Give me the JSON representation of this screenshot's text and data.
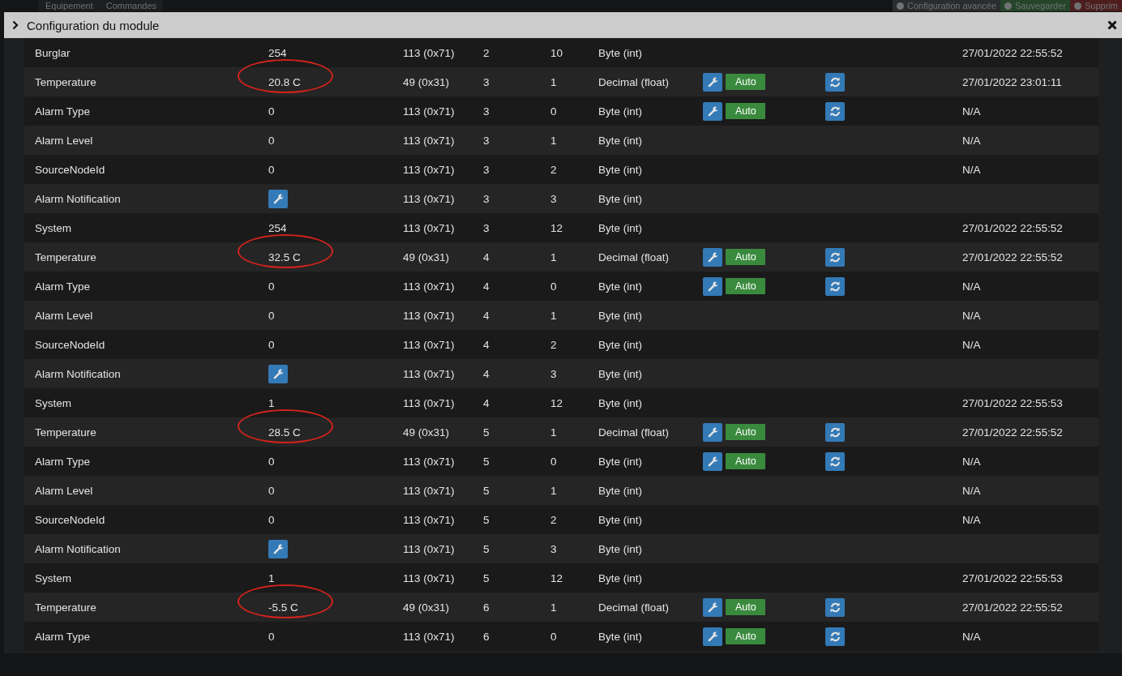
{
  "background_bar": {
    "tabs": [
      "Equipement",
      "Commandes"
    ],
    "buttons": [
      {
        "kind": "config",
        "label": "Configuration avancée"
      },
      {
        "kind": "save",
        "label": "Sauvegarder"
      },
      {
        "kind": "delete",
        "label": "Supprim"
      }
    ]
  },
  "modal": {
    "title": "Configuration du module",
    "rows": [
      {
        "name": "Burglar",
        "kind": "text",
        "value": "254",
        "circled": false,
        "instance": "113 (0x71)",
        "col_4": "2",
        "col_5": "10",
        "type": "Byte (int)",
        "actions": false,
        "refresh": false,
        "date": "27/01/2022 22:55:52"
      },
      {
        "name": "Temperature",
        "kind": "text",
        "value": "20.8 C",
        "circled": true,
        "instance": "49 (0x31)",
        "col_4": "3",
        "col_5": "1",
        "type": "Decimal (float)",
        "actions": true,
        "auto_label": "Auto",
        "refresh": true,
        "date": "27/01/2022 23:01:11"
      },
      {
        "name": "Alarm Type",
        "kind": "text",
        "value": "0",
        "circled": false,
        "instance": "113 (0x71)",
        "col_4": "3",
        "col_5": "0",
        "type": "Byte (int)",
        "actions": true,
        "auto_label": "Auto",
        "refresh": true,
        "date": "N/A"
      },
      {
        "name": "Alarm Level",
        "kind": "text",
        "value": "0",
        "circled": false,
        "instance": "113 (0x71)",
        "col_4": "3",
        "col_5": "1",
        "type": "Byte (int)",
        "actions": false,
        "refresh": false,
        "date": "N/A"
      },
      {
        "name": "SourceNodeId",
        "kind": "text",
        "value": "0",
        "circled": false,
        "instance": "113 (0x71)",
        "col_4": "3",
        "col_5": "2",
        "type": "Byte (int)",
        "actions": false,
        "refresh": false,
        "date": "N/A"
      },
      {
        "name": "Alarm Notification",
        "kind": "wrench",
        "circled": false,
        "instance": "113 (0x71)",
        "col_4": "3",
        "col_5": "3",
        "type": "Byte (int)",
        "actions": false,
        "refresh": false
      },
      {
        "name": "System",
        "kind": "text",
        "value": "254",
        "circled": false,
        "instance": "113 (0x71)",
        "col_4": "3",
        "col_5": "12",
        "type": "Byte (int)",
        "actions": false,
        "refresh": false,
        "date": "27/01/2022 22:55:52"
      },
      {
        "name": "Temperature",
        "kind": "text",
        "value": "32.5 C",
        "circled": true,
        "instance": "49 (0x31)",
        "col_4": "4",
        "col_5": "1",
        "type": "Decimal (float)",
        "actions": true,
        "auto_label": "Auto",
        "refresh": true,
        "date": "27/01/2022 22:55:52"
      },
      {
        "name": "Alarm Type",
        "kind": "text",
        "value": "0",
        "circled": false,
        "instance": "113 (0x71)",
        "col_4": "4",
        "col_5": "0",
        "type": "Byte (int)",
        "actions": true,
        "auto_label": "Auto",
        "refresh": true,
        "date": "N/A"
      },
      {
        "name": "Alarm Level",
        "kind": "text",
        "value": "0",
        "circled": false,
        "instance": "113 (0x71)",
        "col_4": "4",
        "col_5": "1",
        "type": "Byte (int)",
        "actions": false,
        "refresh": false,
        "date": "N/A"
      },
      {
        "name": "SourceNodeId",
        "kind": "text",
        "value": "0",
        "circled": false,
        "instance": "113 (0x71)",
        "col_4": "4",
        "col_5": "2",
        "type": "Byte (int)",
        "actions": false,
        "refresh": false,
        "date": "N/A"
      },
      {
        "name": "Alarm Notification",
        "kind": "wrench",
        "circled": false,
        "instance": "113 (0x71)",
        "col_4": "4",
        "col_5": "3",
        "type": "Byte (int)",
        "actions": false,
        "refresh": false
      },
      {
        "name": "System",
        "kind": "text",
        "value": "1",
        "circled": false,
        "instance": "113 (0x71)",
        "col_4": "4",
        "col_5": "12",
        "type": "Byte (int)",
        "actions": false,
        "refresh": false,
        "date": "27/01/2022 22:55:53"
      },
      {
        "name": "Temperature",
        "kind": "text",
        "value": "28.5 C",
        "circled": true,
        "instance": "49 (0x31)",
        "col_4": "5",
        "col_5": "1",
        "type": "Decimal (float)",
        "actions": true,
        "auto_label": "Auto",
        "refresh": true,
        "date": "27/01/2022 22:55:52"
      },
      {
        "name": "Alarm Type",
        "kind": "text",
        "value": "0",
        "circled": false,
        "instance": "113 (0x71)",
        "col_4": "5",
        "col_5": "0",
        "type": "Byte (int)",
        "actions": true,
        "auto_label": "Auto",
        "refresh": true,
        "date": "N/A"
      },
      {
        "name": "Alarm Level",
        "kind": "text",
        "value": "0",
        "circled": false,
        "instance": "113 (0x71)",
        "col_4": "5",
        "col_5": "1",
        "type": "Byte (int)",
        "actions": false,
        "refresh": false,
        "date": "N/A"
      },
      {
        "name": "SourceNodeId",
        "kind": "text",
        "value": "0",
        "circled": false,
        "instance": "113 (0x71)",
        "col_4": "5",
        "col_5": "2",
        "type": "Byte (int)",
        "actions": false,
        "refresh": false,
        "date": "N/A"
      },
      {
        "name": "Alarm Notification",
        "kind": "wrench",
        "circled": false,
        "instance": "113 (0x71)",
        "col_4": "5",
        "col_5": "3",
        "type": "Byte (int)",
        "actions": false,
        "refresh": false
      },
      {
        "name": "System",
        "kind": "text",
        "value": "1",
        "circled": false,
        "instance": "113 (0x71)",
        "col_4": "5",
        "col_5": "12",
        "type": "Byte (int)",
        "actions": false,
        "refresh": false,
        "date": "27/01/2022 22:55:53"
      },
      {
        "name": "Temperature",
        "kind": "text",
        "value": "-5.5 C",
        "circled": true,
        "instance": "49 (0x31)",
        "col_4": "6",
        "col_5": "1",
        "type": "Decimal (float)",
        "actions": true,
        "auto_label": "Auto",
        "refresh": true,
        "date": "27/01/2022 22:55:52"
      },
      {
        "name": "Alarm Type",
        "kind": "text",
        "value": "0",
        "circled": false,
        "instance": "113 (0x71)",
        "col_4": "6",
        "col_5": "0",
        "type": "Byte (int)",
        "actions": true,
        "auto_label": "Auto",
        "refresh": true,
        "date": "N/A"
      }
    ]
  }
}
